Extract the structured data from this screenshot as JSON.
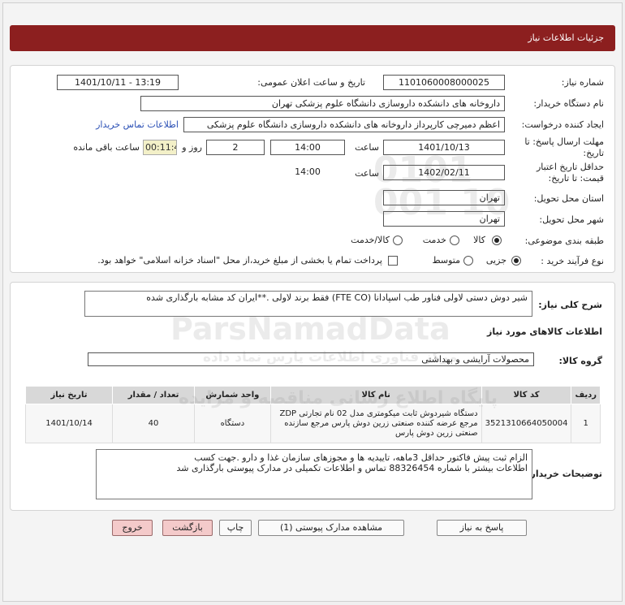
{
  "header": {
    "title": "جزئیات اطلاعات نیاز"
  },
  "form": {
    "need_number_label": "شماره نیاز:",
    "need_number": "1101060008000025",
    "announce_label": "تاریخ و ساعت اعلان عمومی:",
    "announce_value": "1401/10/11 - 13:19",
    "buyer_label": "نام دستگاه خریدار:",
    "buyer_value": "داروخانه های دانشکده داروسازی دانشگاه علوم پزشکی تهران",
    "creator_label": "ایجاد کننده درخواست:",
    "creator_value": "اعظم دمیرچی کارپرداز داروخانه های دانشکده داروسازی دانشگاه علوم پزشکی",
    "contact_link": "اطلاعات تماس خریدار",
    "deadline_label_1": "مهلت ارسال پاسخ: تا",
    "deadline_label_2": "تاریخ:",
    "deadline_date": "1401/10/13",
    "time_label": "ساعت",
    "deadline_time": "14:00",
    "days_value": "2",
    "days_label": "روز و",
    "remaining_time": "00:11:45",
    "remaining_label": "ساعت باقی مانده",
    "validity_label_1": "حداقل تاریخ اعتبار",
    "validity_label_2": "قیمت: تا تاریخ:",
    "validity_date": "1402/02/11",
    "validity_time_label": "ساعت",
    "validity_time": "14:00",
    "province_label": "استان محل تحویل:",
    "province_value": "تهران",
    "city_label": "شهر محل تحویل:",
    "city_value": "تهران",
    "category_label": "طبقه بندی موضوعی:",
    "category_options": [
      "کالا",
      "خدمت",
      "کالا/خدمت"
    ],
    "category_selected": "کالا",
    "purchase_label": "نوع فرآیند خرید :",
    "purchase_options": [
      "جزیی",
      "متوسط"
    ],
    "purchase_selected": "جزیی",
    "payment_check_label": "پرداخت تمام یا بخشی از مبلغ خرید،از محل \"اسناد خزانه اسلامی\" خواهد بود."
  },
  "description": {
    "label": "شرح کلی نیاز:",
    "value": "شیر دوش  دستی لاولی فناور طب اسپادانا (FTE CO) فقط برند لاولی .**ایران کد مشابه بارگذاری شده"
  },
  "goods": {
    "section_title": "اطلاعات کالاهای مورد نیاز",
    "group_label": "گروه کالا:",
    "group_value": "محصولات آرایشی و بهداشتی",
    "columns": [
      "ردیف",
      "کد کالا",
      "نام کالا",
      "واحد شمارش",
      "تعداد / مقدار",
      "تاریخ نیاز"
    ],
    "rows": [
      {
        "index": "1",
        "code": "3521310664050004",
        "name_1": "دستگاه شیردوش ثابت میکومتری مدل 02 نام تجارتی ZDP",
        "name_2": "مرجع عرضه کننده صنعتی زرین دوش پارس مرجع سازنده",
        "name_3": "صنعتی زرین دوش پارس",
        "unit": "دستگاه",
        "qty": "40",
        "date": "1401/10/14"
      }
    ]
  },
  "buyer_notes": {
    "label": "توضیحات خریدار:",
    "line_1": "الزام ثبت پیش فاکتور حداقل 3ماهه، تاییدیه ها و مجوزهای سازمان غذا و دارو .جهت کسب",
    "line_2": "اطلاعات بیشتر با شماره 88326454 تماس و اطلاعات تکمیلی در مدارک پیوستی بارگذاری شد"
  },
  "buttons": {
    "reply": "پاسخ به نیاز",
    "attachments": "مشاهده مدارک پیوستی (1)",
    "print": "چاپ",
    "back": "بازگشت",
    "exit": "خروج"
  },
  "watermark": {
    "brand": "ParsNamadData",
    "line_1": "پایگاه اطلاع رسانی مناقصه و مزایده",
    "line_2": "مرکز فناوری اطلاعات پارس نماد داده",
    "number": "0101 001 10"
  }
}
